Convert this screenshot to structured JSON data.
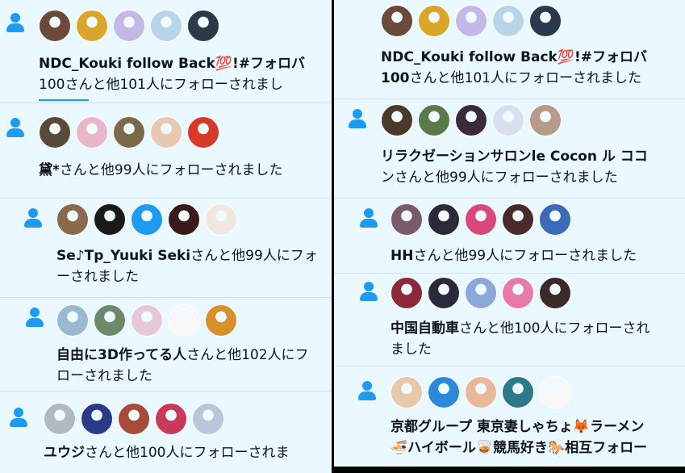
{
  "colors": {
    "accent": "#1d9bf0",
    "background": "#eaf8ff",
    "text": "#0f1419"
  },
  "left": {
    "items": [
      {
        "avatars": [
          "#6b4a3a",
          "#d9a62a",
          "#c4b8e8",
          "#b8d4e8",
          "#2a3a4a"
        ],
        "name": "NDC_Kouki follow Back💯!#フォロバ",
        "rest": "",
        "line2": "100さんと他101人にフォローされまし"
      },
      {
        "avatars": [
          "#5a4a3a",
          "#e8b8c8",
          "#7a6a4a",
          "#e8c8b0",
          "#d83a2a"
        ],
        "name": "",
        "rest": "",
        "line2_name": "黛*",
        "line2": "さんと他99人にフォローされました"
      },
      {
        "avatars": [
          "#8a6a4a",
          "#1a1a1a",
          "#1d9bf0",
          "#3a1a1a",
          "#f0e8e0"
        ],
        "name": "Se♪Tp_Yuuki Seki",
        "rest": "さんと他99人にフォ",
        "line2": "ーされました"
      },
      {
        "avatars": [
          "#9ab8d0",
          "#6a8a6a",
          "#e8c8d8",
          "#f8f8f8",
          "#d8902a"
        ],
        "name": "自由に3D作ってる人",
        "rest": "さんと他102人にフ",
        "line2": "ローされました"
      },
      {
        "avatars": [
          "#b0b8c0",
          "#2a3a8a",
          "#a84a3a",
          "#c83a5a",
          "#b8c8d8"
        ],
        "name": "ユウジ",
        "rest": "さんと他100人にフォローされま",
        "line2": ""
      }
    ]
  },
  "right": {
    "items": [
      {
        "avatars": [
          "#6b4a3a",
          "#d9a62a",
          "#c4b8e8",
          "#b8d4e8",
          "#2a3a4a"
        ],
        "name": "NDC_Kouki follow Back💯!#フォロバ",
        "rest": "",
        "line2_name": "100",
        "line2": "さんと他101人にフォローされました"
      },
      {
        "avatars": [
          "#4a3a2a",
          "#5a7a4a",
          "#3a2a3a",
          "#d8e0f0",
          "#b89a8a"
        ],
        "name": "リラクゼーションサロンle Cocon ル ココ",
        "rest": "",
        "line2": "ンさんと他99人にフォローされました"
      },
      {
        "avatars": [
          "#7a5a6a",
          "#2a2a3a",
          "#d8487a",
          "#4a2a2a",
          "#3a6ab8"
        ],
        "name": "HH",
        "rest": "さんと他99人にフォローされました",
        "line2": ""
      },
      {
        "avatars": [
          "#8a2a3a",
          "#2a2a3a",
          "#8aa8d8",
          "#e87aa8",
          "#3a2a2a"
        ],
        "name": "中国自動車",
        "rest": "さんと他100人にフォローされ",
        "line2": "ました"
      },
      {
        "avatars": [
          "#e8c8a8",
          "#2a8ad8",
          "#e8b89a",
          "#2a7a8a",
          "#f8f8f8"
        ],
        "name": "京都グループ 東京妻しゃちょ🦊ラーメン",
        "rest": "",
        "line2": "🍜ハイボール🥃競馬好き🐎相互フォロー"
      }
    ]
  }
}
